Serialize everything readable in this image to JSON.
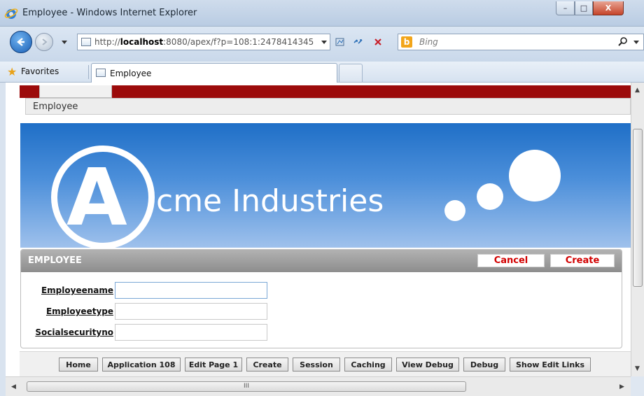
{
  "window": {
    "title": "Employee - Windows Internet Explorer",
    "minimize_glyph": "–",
    "maximize_glyph": "□",
    "close_glyph": "X"
  },
  "address_bar": {
    "url_prefix": "http://",
    "url_host": "localhost",
    "url_rest": ":8080/apex/f?p=108:1:2478414345",
    "search_placeholder": "Bing",
    "bing_logo": "b"
  },
  "favorites_bar": {
    "favorites_label": "Favorites",
    "tab_label": "Employee"
  },
  "page": {
    "breadcrumb": "Employee",
    "banner": {
      "logo_letter": "A",
      "company_text": "cme Industries"
    },
    "region": {
      "title": "EMPLOYEE",
      "cancel_label": "Cancel",
      "create_label": "Create",
      "fields": [
        {
          "label": "Employeename",
          "value": ""
        },
        {
          "label": "Employeetype",
          "value": ""
        },
        {
          "label": "Socialsecurityno",
          "value": ""
        }
      ]
    },
    "dev_toolbar": [
      "Home",
      "Application 108",
      "Edit Page 1",
      "Create",
      "Session",
      "Caching",
      "View Debug",
      "Debug",
      "Show Edit Links"
    ]
  },
  "scrollbar": {
    "h_grip": "III"
  },
  "colors": {
    "accent_red": "#9c0b0b",
    "button_text_red": "#d20000",
    "banner_top": "#1f6fc7",
    "banner_bottom": "#9fc1ec"
  },
  "icons": [
    "ie-icon",
    "back-icon",
    "forward-icon",
    "page-icon",
    "compat-icon",
    "refresh-icon",
    "stop-icon",
    "bing-icon",
    "search-icon",
    "favorites-star-icon"
  ]
}
